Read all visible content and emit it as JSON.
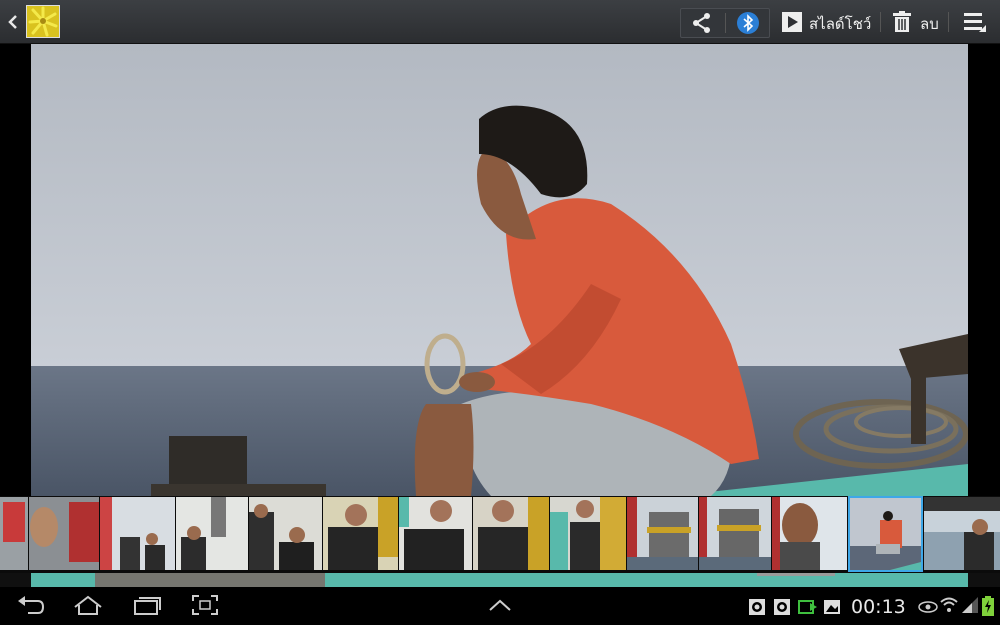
{
  "topbar": {
    "slideshow_label": "สไลด์โชว์",
    "delete_label": "ลบ"
  },
  "status": {
    "time": "00:13"
  },
  "colors": {
    "bluetooth": "#2b7fd6",
    "bar": "#2e3034",
    "selected_border": "#3ea7e8"
  },
  "icons": [
    "back-icon",
    "share-icon",
    "bluetooth-icon",
    "slideshow-play-icon",
    "trash-icon",
    "menu-icon",
    "nav-back-icon",
    "home-icon",
    "recent-apps-icon",
    "screenshot-icon",
    "up-chevron-icon",
    "wifi-icon",
    "signal-icon",
    "battery-icon"
  ]
}
